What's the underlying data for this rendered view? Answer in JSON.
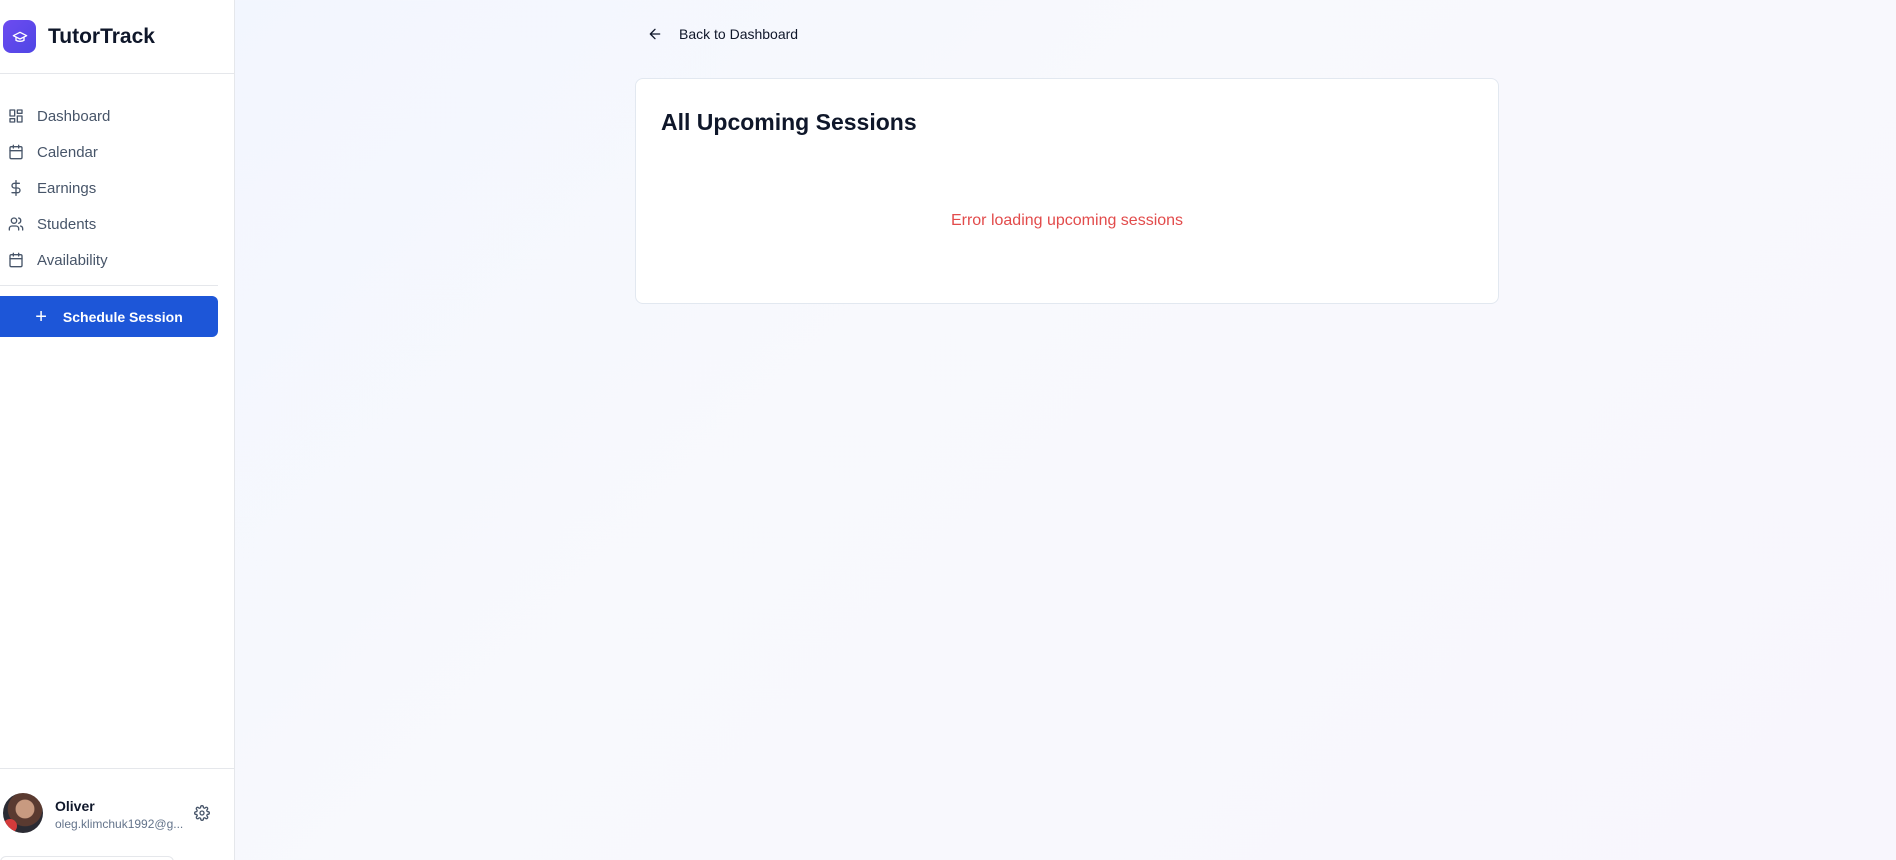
{
  "brand": {
    "name": "TutorTrack",
    "logo_icon": "graduation-cap-icon",
    "accent": "#5b46ea"
  },
  "sidebar": {
    "items": [
      {
        "label": "Dashboard",
        "icon": "grid-icon"
      },
      {
        "label": "Calendar",
        "icon": "calendar-icon"
      },
      {
        "label": "Earnings",
        "icon": "dollar-icon"
      },
      {
        "label": "Students",
        "icon": "users-icon"
      },
      {
        "label": "Availability",
        "icon": "calendar-icon"
      }
    ],
    "schedule_button": {
      "label": "Schedule Session",
      "color": "#1d56d8"
    }
  },
  "user": {
    "name": "Oliver",
    "email": "oleg.klimchuk1992@g..."
  },
  "main": {
    "back_label": "Back to Dashboard",
    "card_title": "All Upcoming Sessions",
    "error_text": "Error loading upcoming sessions",
    "error_color": "#e24b4b"
  }
}
